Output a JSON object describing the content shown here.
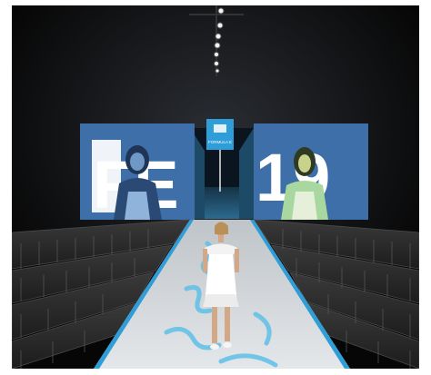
{
  "scene": {
    "left_screen_text": "FE",
    "right_screen_text": "19",
    "center_logo_text": "FORMULA E",
    "colors": {
      "screen_blue": "#3f6fa8",
      "accent_blue": "#2f9ed8",
      "runway": "#d9dde0",
      "runway_mark": "#5fc0e8",
      "background": "#0a0a0a"
    }
  }
}
